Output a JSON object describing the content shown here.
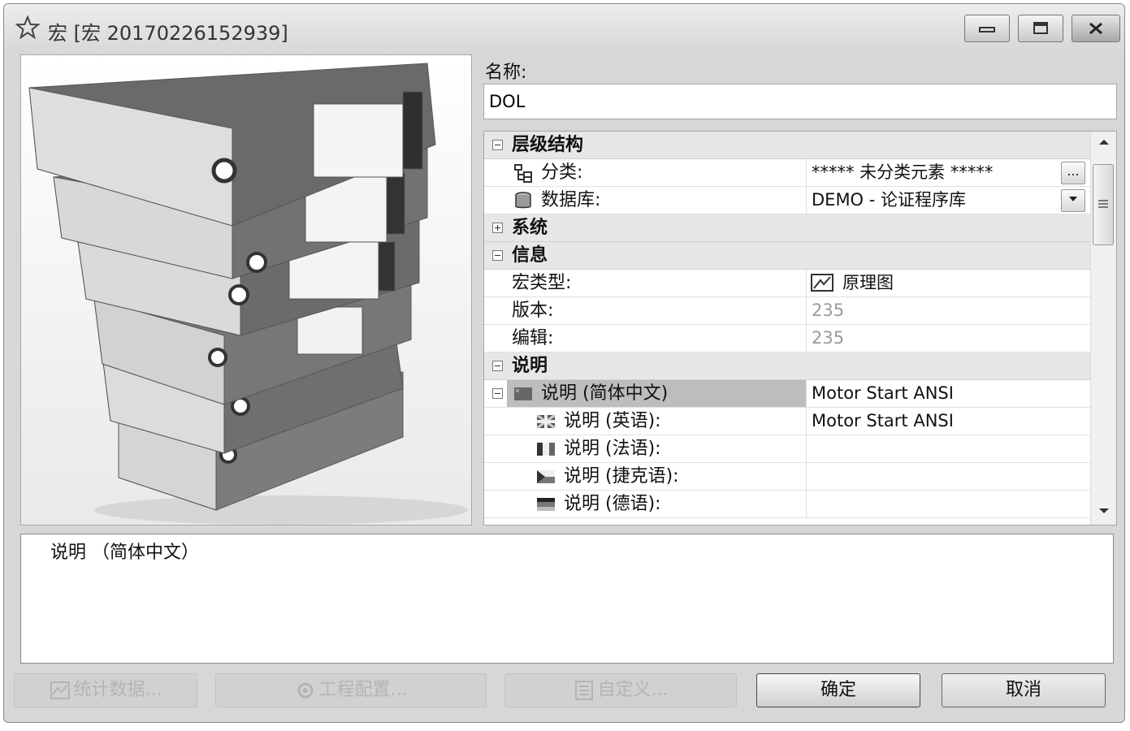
{
  "window": {
    "title": "宏 [宏 20170226152939]"
  },
  "form": {
    "name_label": "名称:",
    "name_value": "DOL"
  },
  "properties": {
    "hierarchy": {
      "label": "层级结构",
      "classification": {
        "key": "分类:",
        "value": "***** 未分类元素 *****",
        "button": "..."
      },
      "database": {
        "key": "数据库:",
        "value": "DEMO - 论证程序库"
      }
    },
    "system": {
      "label": "系统"
    },
    "info": {
      "label": "信息",
      "macro_type": {
        "key": "宏类型:",
        "value": "原理图"
      },
      "version": {
        "key": "版本:",
        "value": "235"
      },
      "edit": {
        "key": "编辑:",
        "value": "235"
      }
    },
    "description": {
      "label": "说明",
      "zh": {
        "key": "说明 (简体中文)",
        "value": "Motor Start ANSI"
      },
      "en": {
        "key": "说明 (英语):",
        "value": "Motor Start ANSI"
      },
      "fr": {
        "key": "说明 (法语):",
        "value": ""
      },
      "cs": {
        "key": "说明 (捷克语):",
        "value": ""
      },
      "de": {
        "key": "说明 (德语):",
        "value": ""
      }
    }
  },
  "description_box": {
    "text": "说明 （简体中文）"
  },
  "buttons": {
    "stats": "统计数据...",
    "project_config": "工程配置...",
    "custom": "自定义...",
    "ok": "确定",
    "cancel": "取消"
  }
}
